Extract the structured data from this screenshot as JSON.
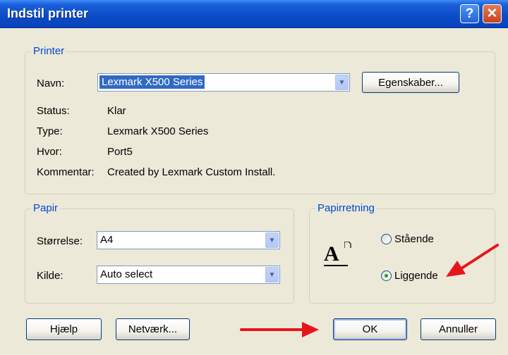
{
  "window": {
    "title": "Indstil printer",
    "help_glyph": "?",
    "close_glyph": "✕"
  },
  "printer": {
    "group_title": "Printer",
    "name_label": "Navn:",
    "name_value": "Lexmark X500 Series",
    "properties_button": "Egenskaber...",
    "status_label": "Status:",
    "status_value": "Klar",
    "type_label": "Type:",
    "type_value": "Lexmark X500 Series",
    "where_label": "Hvor:",
    "where_value": "Port5",
    "comment_label": "Kommentar:",
    "comment_value": "Created by Lexmark Custom Install."
  },
  "paper": {
    "group_title": "Papir",
    "size_label": "Størrelse:",
    "size_value": "A4",
    "source_label": "Kilde:",
    "source_value": "Auto select"
  },
  "orientation": {
    "group_title": "Papirretning",
    "icon_letter": "A",
    "portrait_label": "Stående",
    "landscape_label": "Liggende",
    "selected": "Liggende"
  },
  "buttons": {
    "help": "Hjælp",
    "network": "Netværk...",
    "ok": "OK",
    "cancel": "Annuller"
  },
  "colors": {
    "annotation_arrow": "#e8141c",
    "titlebar": "#0a46c0",
    "group_title": "#0046d5"
  },
  "icons": {
    "dropdown": "chevron-down-icon",
    "orientation_preview": "landscape-page-icon",
    "annotation": "red-arrow-icon"
  }
}
